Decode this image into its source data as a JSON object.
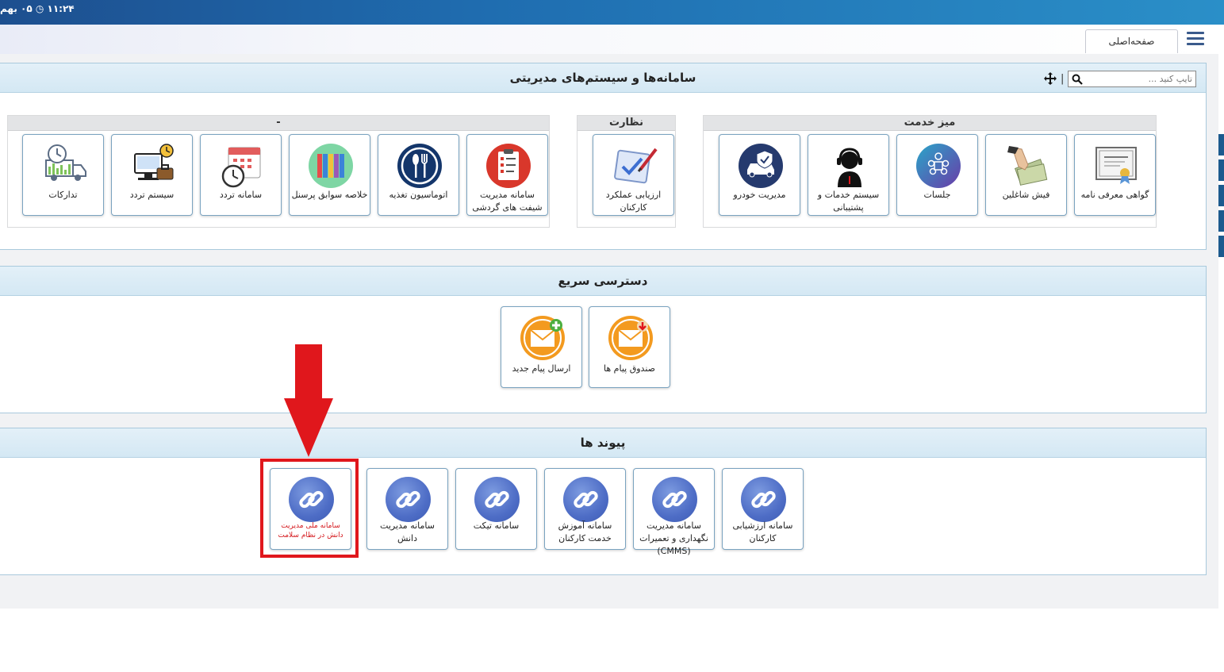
{
  "topbar": {
    "clock_text": "۱۱:۲۴ ◷ ۰۵ بهم"
  },
  "tabs": {
    "home_label": "صفحه‌اصلی"
  },
  "systems_panel": {
    "title": "سامانه‌ها و سیستم‌های مدیریتی",
    "search_placeholder": "تایپ کنید ...",
    "separator": "|",
    "groups": {
      "service_desk": {
        "title": "میز خدمت",
        "items": [
          {
            "label": "گواهی معرفی نامه",
            "icon": "certificate-icon"
          },
          {
            "label": "فیش شاغلین",
            "icon": "cash-hand-icon"
          },
          {
            "label": "جلسات",
            "icon": "meeting-icon"
          },
          {
            "label": "سیستم خدمات و پشتیبانی",
            "icon": "support-agent-icon"
          },
          {
            "label": "مدیریت خودرو",
            "icon": "car-shield-icon"
          }
        ]
      },
      "supervision": {
        "title": "نظارت",
        "items": [
          {
            "label": "ارزیابی عملکرد کارکنان",
            "icon": "checklist-pen-icon"
          }
        ]
      },
      "other": {
        "title": "-",
        "items": [
          {
            "label": "سامانه مدیریت شیفت های گردشی",
            "icon": "clipboard-icon"
          },
          {
            "label": "اتوماسیون تغذیه",
            "icon": "cutlery-icon"
          },
          {
            "label": "خلاصه سوابق پرسنل",
            "icon": "binders-icon"
          },
          {
            "label": "سامانه تردد",
            "icon": "calendar-clock-icon"
          },
          {
            "label": "سیستم تردد",
            "icon": "computer-bag-icon"
          },
          {
            "label": "تدارکات",
            "icon": "delivery-truck-icon"
          }
        ]
      }
    }
  },
  "quick_access": {
    "title": "دسترسی سریع",
    "items": [
      {
        "label": "صندوق پیام ها",
        "icon": "inbox-mail-icon"
      },
      {
        "label": "ارسال پیام جدید",
        "icon": "new-mail-icon"
      }
    ]
  },
  "links": {
    "title": "پیوند ها",
    "items": [
      {
        "label": "سامانه ارزشیابی کارکنان"
      },
      {
        "label": "سامانه مدیریت نگهداری و تعمیرات (CMMS)"
      },
      {
        "label": "سامانه آموزش خدمت کارکنان"
      },
      {
        "label": "سامانه تیکت"
      },
      {
        "label": "سامانه مدیریت دانش"
      },
      {
        "label": "سامانه ملی مدیریت دانش در نظام سلامت"
      }
    ]
  },
  "colors": {
    "accent_red": "#e0171c",
    "header_blue": "#1f6db0",
    "link_icon": "#4e6dc6"
  }
}
